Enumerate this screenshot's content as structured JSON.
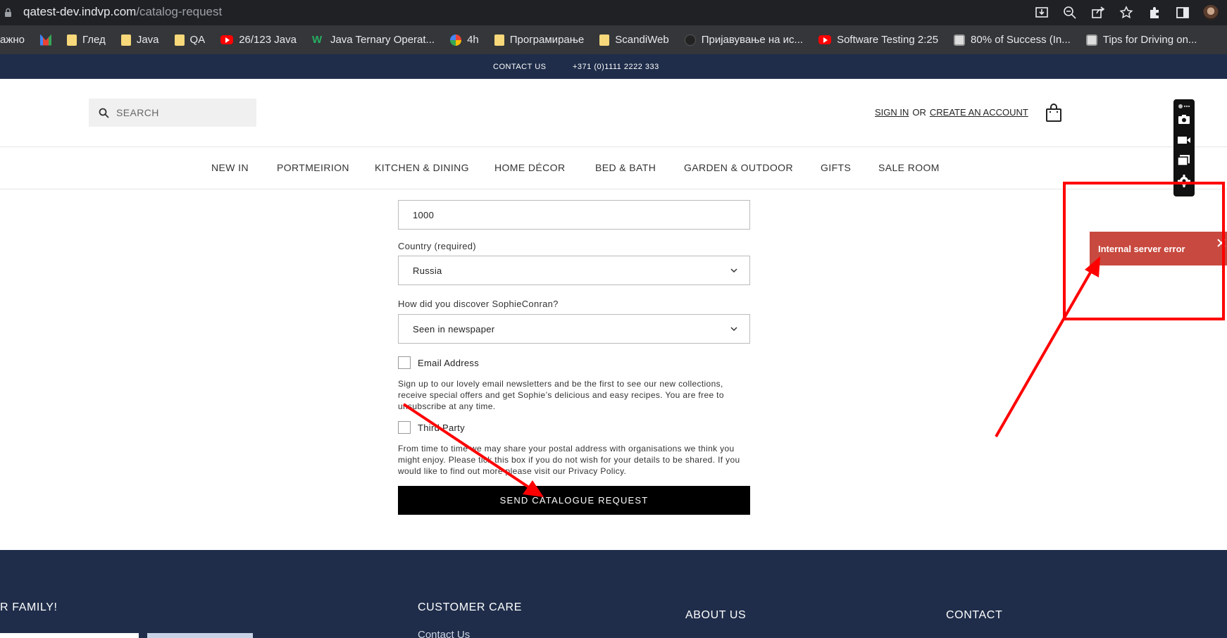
{
  "browser": {
    "url_host": "qatest-dev.indvp.com",
    "url_path": "/catalog-request",
    "bookmarks": [
      {
        "icon": "none",
        "label": "ажно"
      },
      {
        "icon": "gmail-icon",
        "label": ""
      },
      {
        "icon": "folder-icon",
        "label": "Глед"
      },
      {
        "icon": "folder-icon",
        "label": "Java"
      },
      {
        "icon": "folder-icon",
        "label": "QA"
      },
      {
        "icon": "youtube-icon",
        "label": "26/123 Java"
      },
      {
        "icon": "w-icon",
        "label": "Java Ternary Operat..."
      },
      {
        "icon": "google-icon",
        "label": "4h"
      },
      {
        "icon": "folder-icon",
        "label": "Програмирање"
      },
      {
        "icon": "folder-icon",
        "label": "ScandiWeb"
      },
      {
        "icon": "site-icon",
        "label": "Пријавување на ис..."
      },
      {
        "icon": "youtube-icon",
        "label": "Software Testing 2:25"
      },
      {
        "icon": "image-icon",
        "label": "80% of Success (In..."
      },
      {
        "icon": "image-icon",
        "label": "Tips for Driving on..."
      }
    ]
  },
  "topbar": {
    "contact": "CONTACT US",
    "phone": "+371 (0)1111 2222 333"
  },
  "header": {
    "search_placeholder": "SEARCH",
    "sign_in": "SIGN IN",
    "or": "OR",
    "create_account": "CREATE AN ACCOUNT"
  },
  "nav": {
    "new_in": "NEW IN",
    "portmeirion": "PORTMEIRION",
    "kitchen": "KITCHEN & DINING",
    "home_decor": "HOME DÉCOR",
    "bed_bath": "BED & BATH",
    "garden": "GARDEN & OUTDOOR",
    "gifts": "GIFTS",
    "sale": "SALE ROOM"
  },
  "form": {
    "postcode_value": "1000",
    "country_label": "Country (required)",
    "country_value": "Russia",
    "discover_label": "How did you discover SophieConran?",
    "discover_value": "Seen in newspaper",
    "email_label": "Email Address",
    "email_text": "Sign up to our lovely email newsletters and be the first to see our new collections, receive special offers and get Sophie’s delicious and easy recipes. You are free to unsubscribe at any time.",
    "third_party_label": "Third Party",
    "third_party_text": "From time to time we may share your postal address with organisations we think you might enjoy. Please tick this box if you do not wish for your details to be shared. If you would like to find out more please visit our Privacy Policy.",
    "submit_label": "SEND CATALOGUE REQUEST"
  },
  "footer": {
    "family": "R FAMILY!",
    "customer_care": "CUSTOMER CARE",
    "contact_us_link": "Contact Us",
    "about_us": "ABOUT US",
    "contact": "CONTACT"
  },
  "toast": {
    "message": "Internal server error"
  },
  "colors": {
    "navy": "#1f2d4a",
    "toast_bg": "#c8493f",
    "annotation_red": "#ff0000"
  }
}
